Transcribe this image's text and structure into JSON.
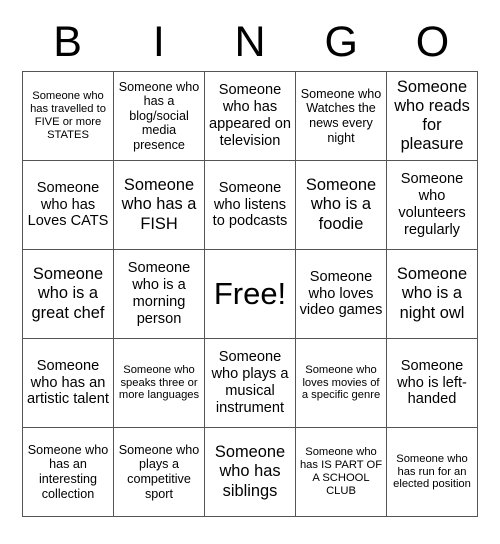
{
  "header": {
    "letters": [
      "B",
      "I",
      "N",
      "G",
      "O"
    ]
  },
  "grid": {
    "rows": 5,
    "columns": 5,
    "cells": [
      {
        "text": "Someone who has travelled to FIVE or more STATES",
        "size": "xs"
      },
      {
        "text": "Someone who has a blog/social media presence",
        "size": "sm"
      },
      {
        "text": "Someone who has appeared on television",
        "size": "md"
      },
      {
        "text": "Someone who Watches the news every night",
        "size": "sm"
      },
      {
        "text": "Someone who reads for pleasure",
        "size": "lg"
      },
      {
        "text": "Someone who has Loves CATS",
        "size": "md"
      },
      {
        "text": "Someone who has a FISH",
        "size": "lg"
      },
      {
        "text": "Someone who listens to podcasts",
        "size": "md"
      },
      {
        "text": "Someone who is a foodie",
        "size": "lg"
      },
      {
        "text": "Someone who volunteers regularly",
        "size": "md"
      },
      {
        "text": "Someone who is a great chef",
        "size": "lg"
      },
      {
        "text": "Someone who is a morning person",
        "size": "md"
      },
      {
        "text": "Free!",
        "size": "free"
      },
      {
        "text": "Someone who loves video games",
        "size": "md"
      },
      {
        "text": "Someone who is a night owl",
        "size": "lg"
      },
      {
        "text": "Someone who has an artistic talent",
        "size": "md"
      },
      {
        "text": "Someone who speaks three or more languages",
        "size": "xs"
      },
      {
        "text": "Someone who plays a musical instrument",
        "size": "md"
      },
      {
        "text": "Someone who loves movies of a specific genre",
        "size": "xs"
      },
      {
        "text": "Someone who is left-handed",
        "size": "md"
      },
      {
        "text": "Someone who has an interesting collection",
        "size": "sm"
      },
      {
        "text": "Someone who plays a competitive sport",
        "size": "sm"
      },
      {
        "text": "Someone who has siblings",
        "size": "lg"
      },
      {
        "text": "Someone who has IS PART OF A SCHOOL CLUB",
        "size": "xs"
      },
      {
        "text": "Someone who has run for an elected position",
        "size": "xs"
      }
    ]
  },
  "colors": {
    "background": "#ffffff",
    "text": "#000000",
    "grid_line": "#555555"
  }
}
